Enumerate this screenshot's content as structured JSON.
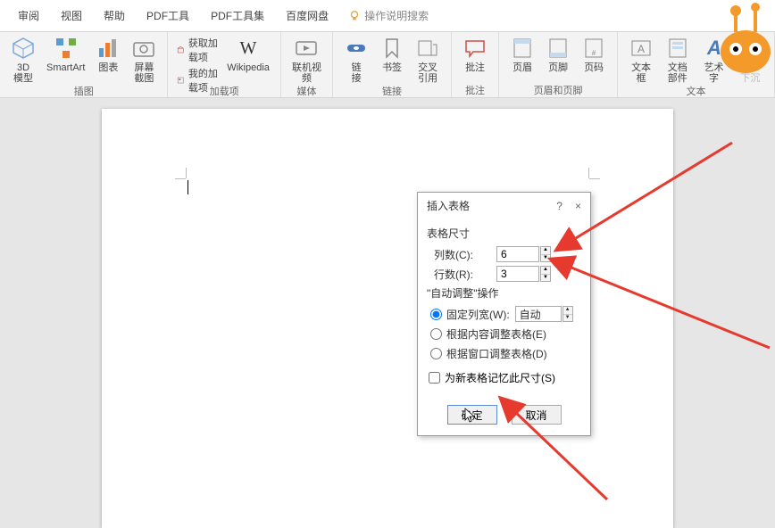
{
  "tabs": [
    "审阅",
    "视图",
    "帮助",
    "PDF工具",
    "PDF工具集",
    "百度网盘"
  ],
  "search_placeholder": "操作说明搜索",
  "groups": {
    "illustration": {
      "model3d": "3D\n模型",
      "smartart": "SmartArt",
      "chart": "图表",
      "screenshot": "屏幕截图",
      "label": "插图"
    },
    "addins": {
      "get": "获取加载项",
      "my": "我的加载项",
      "wikipedia": "Wikipedia",
      "label": "加载项"
    },
    "media": {
      "video": "联机视频",
      "label": "媒体"
    },
    "links": {
      "link": "链\n接",
      "bookmark": "书签",
      "crossref": "交叉引用",
      "label": "链接"
    },
    "comments": {
      "comment": "批注",
      "label": "批注"
    },
    "headerfooter": {
      "header": "页眉",
      "footer": "页脚",
      "pagenum": "页码",
      "label": "页眉和页脚"
    },
    "text": {
      "textbox": "文本框",
      "quickparts": "文档部件",
      "wordart": "艺术字",
      "dropcap": "首字下沉",
      "label": "文本"
    }
  },
  "dialog": {
    "title": "插入表格",
    "help": "?",
    "close": "×",
    "size_section": "表格尺寸",
    "cols_label": "列数(C):",
    "cols_value": "6",
    "rows_label": "行数(R):",
    "rows_value": "3",
    "autofit_section": "\"自动调整\"操作",
    "fixed_width": "固定列宽(W):",
    "fixed_width_value": "自动",
    "autofit_content": "根据内容调整表格(E)",
    "autofit_window": "根据窗口调整表格(D)",
    "remember": "为新表格记忆此尺寸(S)",
    "ok": "确定",
    "cancel": "取消"
  }
}
